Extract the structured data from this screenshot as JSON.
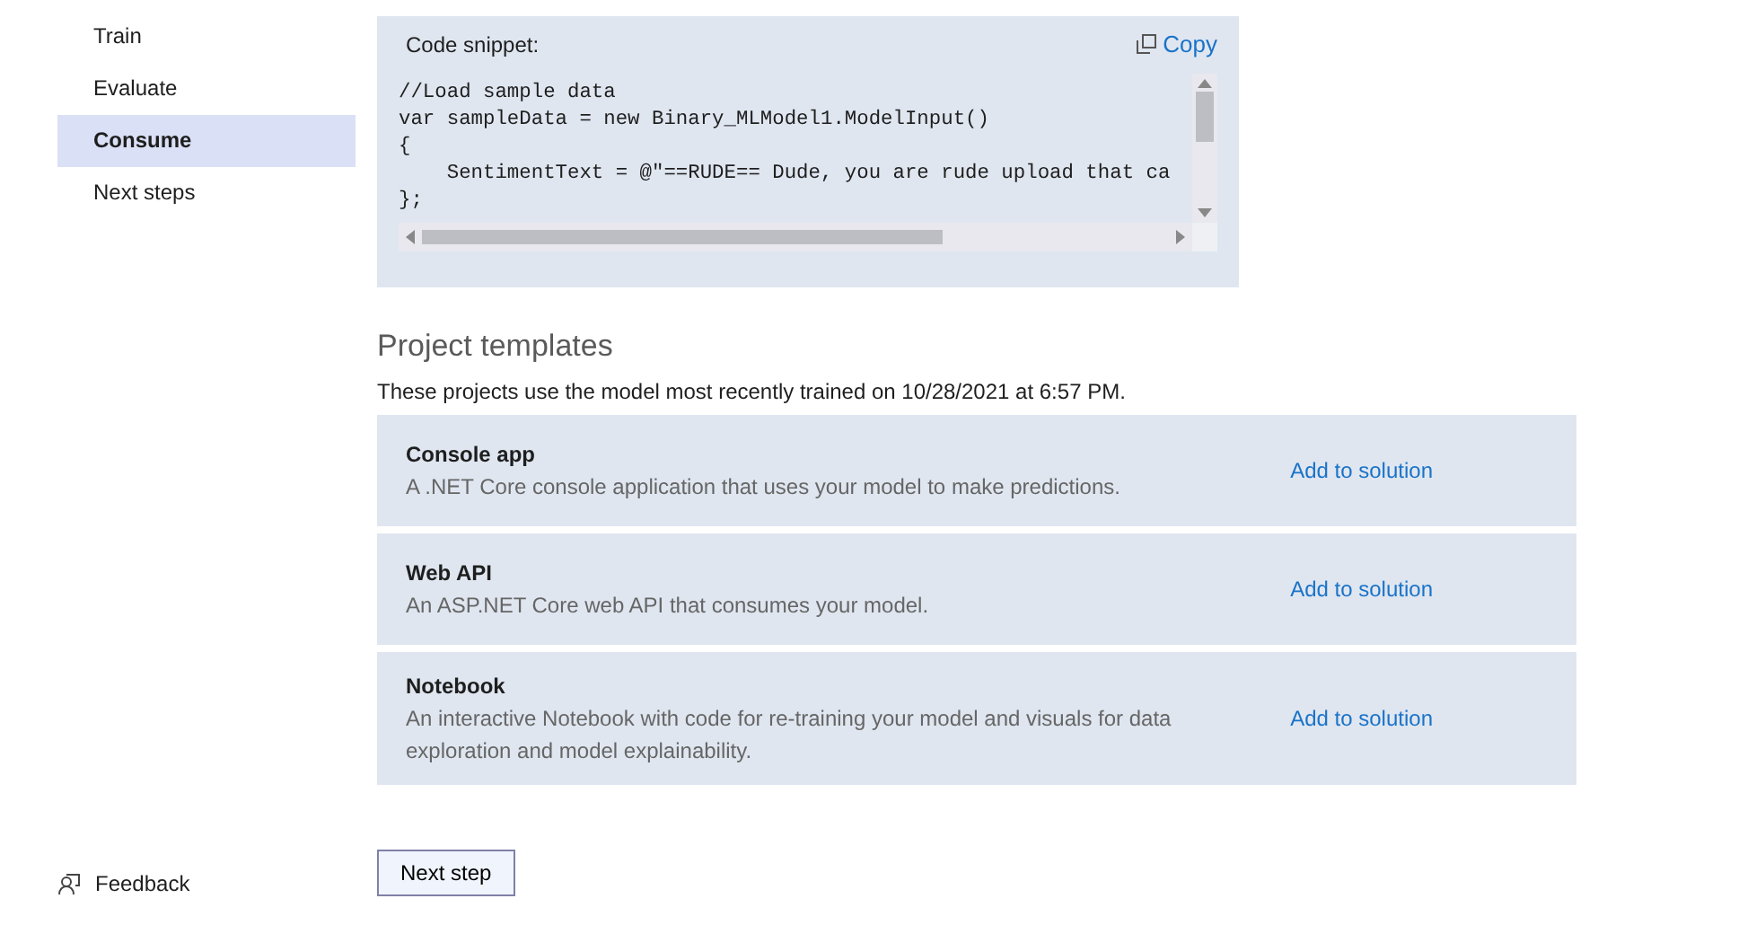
{
  "sidebar": {
    "items": [
      {
        "label": "Train",
        "selected": false
      },
      {
        "label": "Evaluate",
        "selected": false
      },
      {
        "label": "Consume",
        "selected": true
      },
      {
        "label": "Next steps",
        "selected": false
      }
    ],
    "feedback": "Feedback"
  },
  "code_snippet": {
    "title": "Code snippet:",
    "copy": "Copy",
    "lines": [
      "//Load sample data",
      "var sampleData = new Binary_MLModel1.ModelInput()",
      "{",
      "    SentimentText = @\"==RUDE== Dude, you are rude upload that ca",
      "};"
    ]
  },
  "project_templates": {
    "heading": "Project templates",
    "note": "These projects use the model most recently trained on 10/28/2021 at 6:57 PM.",
    "templates": [
      {
        "name": "Console app",
        "description": "A .NET Core console application that uses your model to make predictions.",
        "action": "Add to solution"
      },
      {
        "name": "Web API",
        "description": "An ASP.NET Core web API that consumes your model.",
        "action": "Add to solution"
      },
      {
        "name": "Notebook",
        "description": "An interactive Notebook with code for re-training your model and visuals for data exploration and model explainability.",
        "action": "Add to solution"
      }
    ]
  },
  "next_button": "Next step"
}
